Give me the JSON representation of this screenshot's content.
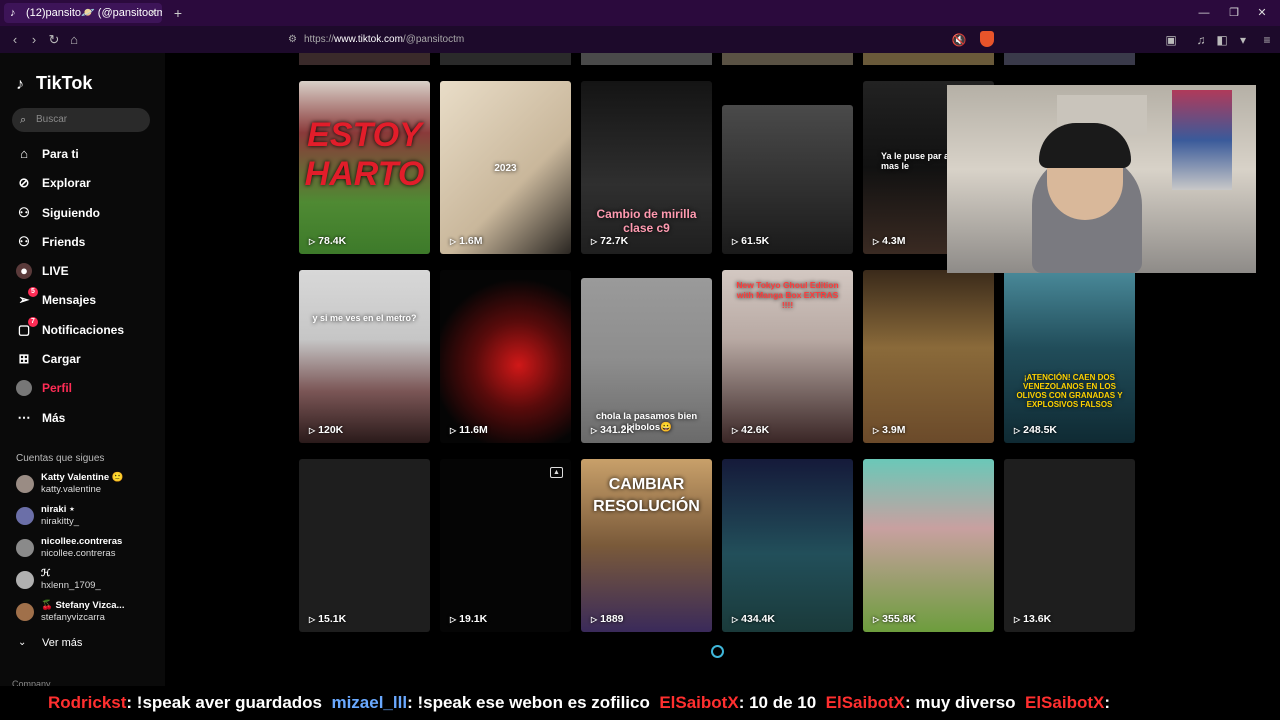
{
  "browser": {
    "tab_title": "(12)pansito🪐 (@pansitoctm) | ",
    "tab_close": "×",
    "new_tab": "+",
    "url_prefix": "https://",
    "url_host": "www.tiktok.com",
    "url_path": "/@pansitoctm"
  },
  "sidebar": {
    "logo": "TikTok",
    "search_placeholder": "Buscar",
    "items": [
      {
        "label": "Para ti",
        "icon": "home-icon"
      },
      {
        "label": "Explorar",
        "icon": "compass-icon"
      },
      {
        "label": "Siguiendo",
        "icon": "following-icon"
      },
      {
        "label": "Friends",
        "icon": "friends-icon"
      },
      {
        "label": "LIVE",
        "icon": "live-icon"
      },
      {
        "label": "Mensajes",
        "icon": "messages-icon",
        "badge": "5"
      },
      {
        "label": "Notificaciones",
        "icon": "notifications-icon",
        "badge": "7"
      },
      {
        "label": "Cargar",
        "icon": "upload-icon"
      },
      {
        "label": "Perfil",
        "icon": "avatar",
        "active": true
      },
      {
        "label": "Más",
        "icon": "more-icon"
      }
    ],
    "following_title": "Cuentas que sigues",
    "accounts": [
      {
        "name": "Katty Valentine 🙂",
        "handle": "katty.valentine"
      },
      {
        "name": "niraki ⋆",
        "handle": "nirakitty_"
      },
      {
        "name": "nicollee.contreras",
        "handle": "nicollee.contreras"
      },
      {
        "name": "ℋ",
        "handle": "hxlenn_1709_"
      },
      {
        "name": "🍒 Stefany Vizca...",
        "handle": "stefanyvizcarra"
      }
    ],
    "see_more": "Ver más",
    "company": "Company"
  },
  "videos": [
    {
      "views": "78.4K",
      "caption": "ESTOY HARTO",
      "color": "#3d7a2a"
    },
    {
      "views": "1.6M",
      "caption": "2023",
      "color": "#c9b79b"
    },
    {
      "views": "72.7K",
      "caption": "Cambio de mirilla clase c9",
      "color": "#2f2f2f"
    },
    {
      "views": "61.5K",
      "caption": "",
      "color": "#3b3b3b"
    },
    {
      "views": "4.3M",
      "caption": "Ya le puse par ahora que mas le",
      "color": "#1a1a1a"
    },
    {
      "views": "120K",
      "caption": "y si me ves en el metro?",
      "color": "#7b5656"
    },
    {
      "views": "11.6M",
      "caption": "",
      "color": "#5a0b0b"
    },
    {
      "views": "341.2K",
      "caption": "chola la pasamos bien chibolos😀",
      "color": "#8d8d8d"
    },
    {
      "views": "42.6K",
      "caption": "New Tokyo Ghoul Edition with Manga Box EXTRAS !!!!",
      "color": "#b8a9a3"
    },
    {
      "views": "3.9M",
      "caption": "",
      "color": "#6b4a2a"
    },
    {
      "views": "248.5K",
      "caption": "¡ATENCIÓN! CAEN DOS VENEZOLANOS EN LOS OLIVOS CON GRANADAS Y EXPLOSIVOS FALSOS",
      "color": "#214d5a"
    },
    {
      "views": "15.1K",
      "caption": "",
      "color": "#1e1e1e"
    },
    {
      "views": "19.1K",
      "caption": "",
      "color": "#050505"
    },
    {
      "views": "1889",
      "caption": "CAMBIAR RESOLUCIÓN",
      "color": "#7a5a3a"
    },
    {
      "views": "434.4K",
      "caption": "",
      "color": "#224f5a"
    },
    {
      "views": "355.8K",
      "caption": "",
      "color": "#6d9d3d"
    },
    {
      "views": "13.6K",
      "caption": "",
      "color": "#1e1e1e"
    }
  ],
  "chat": {
    "lines": [
      {
        "user": "Rodrickst",
        "msg": ": !speak aver guardados"
      },
      {
        "user": "mizael_lll",
        "msg": ": !speak ese webon es zofilico"
      },
      {
        "user": "ElSaibotX",
        "msg": ": 10 de 10"
      },
      {
        "user": "ElSaibotX",
        "msg": ": muy diverso"
      },
      {
        "user": "ElSaibotX",
        "msg": ":"
      }
    ]
  }
}
